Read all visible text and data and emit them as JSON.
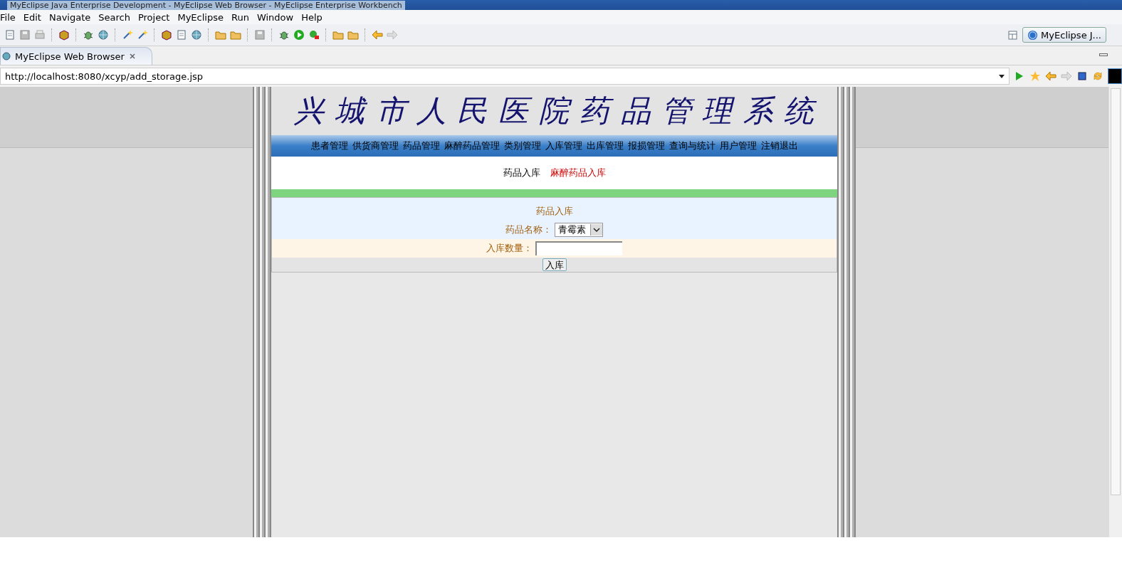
{
  "window": {
    "title": "MyEclipse Java Enterprise Development - MyEclipse Web Browser - MyEclipse Enterprise Workbench"
  },
  "menu": [
    "File",
    "Edit",
    "Navigate",
    "Search",
    "Project",
    "MyEclipse",
    "Run",
    "Window",
    "Help"
  ],
  "perspective": {
    "label": "MyEclipse J..."
  },
  "tabs": [
    {
      "label": "MyEclipse Web Browser",
      "selected": true
    }
  ],
  "address": {
    "value": "http://localhost:8080/xcyp/add_storage.jsp"
  },
  "page": {
    "banner": "兴 城 市 人 民 医 院 药 品 管 理 系 统",
    "nav": [
      "患者管理",
      "供货商管理",
      "药品管理",
      "麻醉药品管理",
      "类别管理",
      "入库管理",
      "出库管理",
      "报损管理",
      "查询与统计",
      "用户管理",
      "注销退出"
    ],
    "subnav": [
      {
        "label": "药品入库",
        "selected": true
      },
      {
        "label": "麻醉药品入库",
        "selected": false
      }
    ],
    "form": {
      "title": "药品入库",
      "fields": [
        {
          "kind": "select",
          "label": "药品名称：",
          "value": "青霉素"
        },
        {
          "kind": "text",
          "label": "入库数量："
        }
      ],
      "submit": "入库"
    }
  }
}
